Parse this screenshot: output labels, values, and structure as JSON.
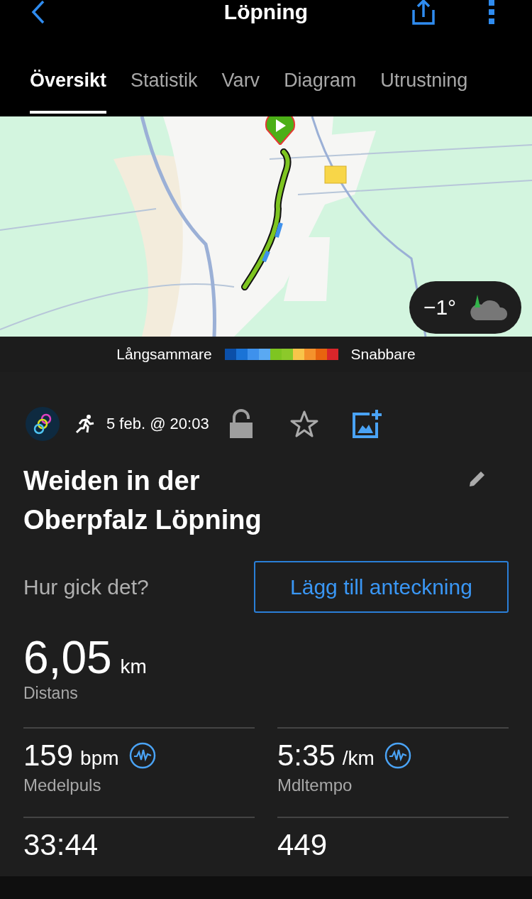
{
  "header": {
    "title": "Löpning"
  },
  "tabs": [
    {
      "label": "Översikt",
      "selected": true
    },
    {
      "label": "Statistik",
      "selected": false
    },
    {
      "label": "Varv",
      "selected": false
    },
    {
      "label": "Diagram",
      "selected": false
    },
    {
      "label": "Utrustning",
      "selected": false
    }
  ],
  "map": {
    "kind": "picture",
    "weather": {
      "temperature": "−1°"
    }
  },
  "legend": {
    "slow_label": "Långsammare",
    "fast_label": "Snabbare"
  },
  "activity": {
    "date": "5 feb. @ 20:03",
    "locked": false,
    "favorite": false,
    "title": "Weiden in der Oberpfalz Löpning",
    "prompt": "Hur gick det?",
    "note_button": "Lägg till anteckning"
  },
  "distance": {
    "value": "6,05",
    "unit": "km",
    "label": "Distans"
  },
  "metrics": [
    {
      "value": "159",
      "unit": "bpm",
      "label": "Medelpuls",
      "graph_link": true
    },
    {
      "value": "5:35",
      "unit": "/km",
      "label": "Mdltempo",
      "graph_link": true
    },
    {
      "value": "33:44",
      "graph_link": false
    },
    {
      "value": "449",
      "graph_link": false
    }
  ]
}
